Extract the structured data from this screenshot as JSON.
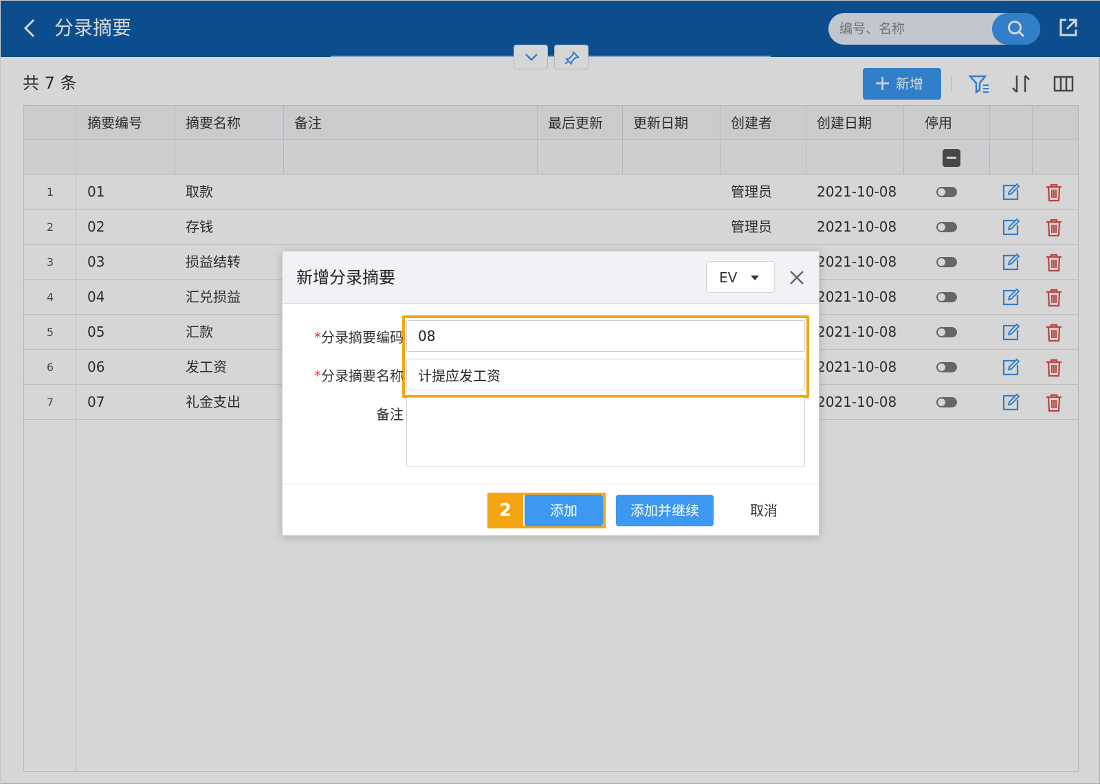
{
  "header": {
    "title": "分录摘要",
    "search_placeholder": "编号、名称"
  },
  "toolbar": {
    "count_text": "共 7 条",
    "add_label": "新增"
  },
  "table": {
    "columns": [
      "摘要编号",
      "摘要名称",
      "备注",
      "最后更新",
      "更新日期",
      "创建者",
      "创建日期",
      "停用"
    ],
    "rows": [
      {
        "index": "1",
        "code": "01",
        "name": "取款",
        "creator": "管理员",
        "created": "2021-10-08"
      },
      {
        "index": "2",
        "code": "02",
        "name": "存钱",
        "creator": "管理员",
        "created": "2021-10-08"
      },
      {
        "index": "3",
        "code": "03",
        "name": "损益结转",
        "creator": "",
        "created": "2021-10-08"
      },
      {
        "index": "4",
        "code": "04",
        "name": "汇兑损益",
        "creator": "",
        "created": "2021-10-08"
      },
      {
        "index": "5",
        "code": "05",
        "name": "汇款",
        "creator": "",
        "created": "2021-10-08"
      },
      {
        "index": "6",
        "code": "06",
        "name": "发工资",
        "creator": "",
        "created": "2021-10-08"
      },
      {
        "index": "7",
        "code": "07",
        "name": "礼金支出",
        "creator": "",
        "created": "2021-10-08"
      }
    ]
  },
  "dialog": {
    "title": "新增分录摘要",
    "language": "EV",
    "fields": {
      "code_label": "分录摘要编码",
      "code_value": "08",
      "name_label": "分录摘要名称",
      "name_value": "计提应发工资",
      "remark_label": "备注",
      "required_mark": "*"
    },
    "step_badge": "2",
    "buttons": {
      "add": "添加",
      "add_continue": "添加并继续",
      "cancel": "取消"
    }
  },
  "colors": {
    "header_bg": "#0f5ea8",
    "primary": "#3c98f0",
    "highlight": "#f5a512",
    "delete": "#e0504a"
  }
}
